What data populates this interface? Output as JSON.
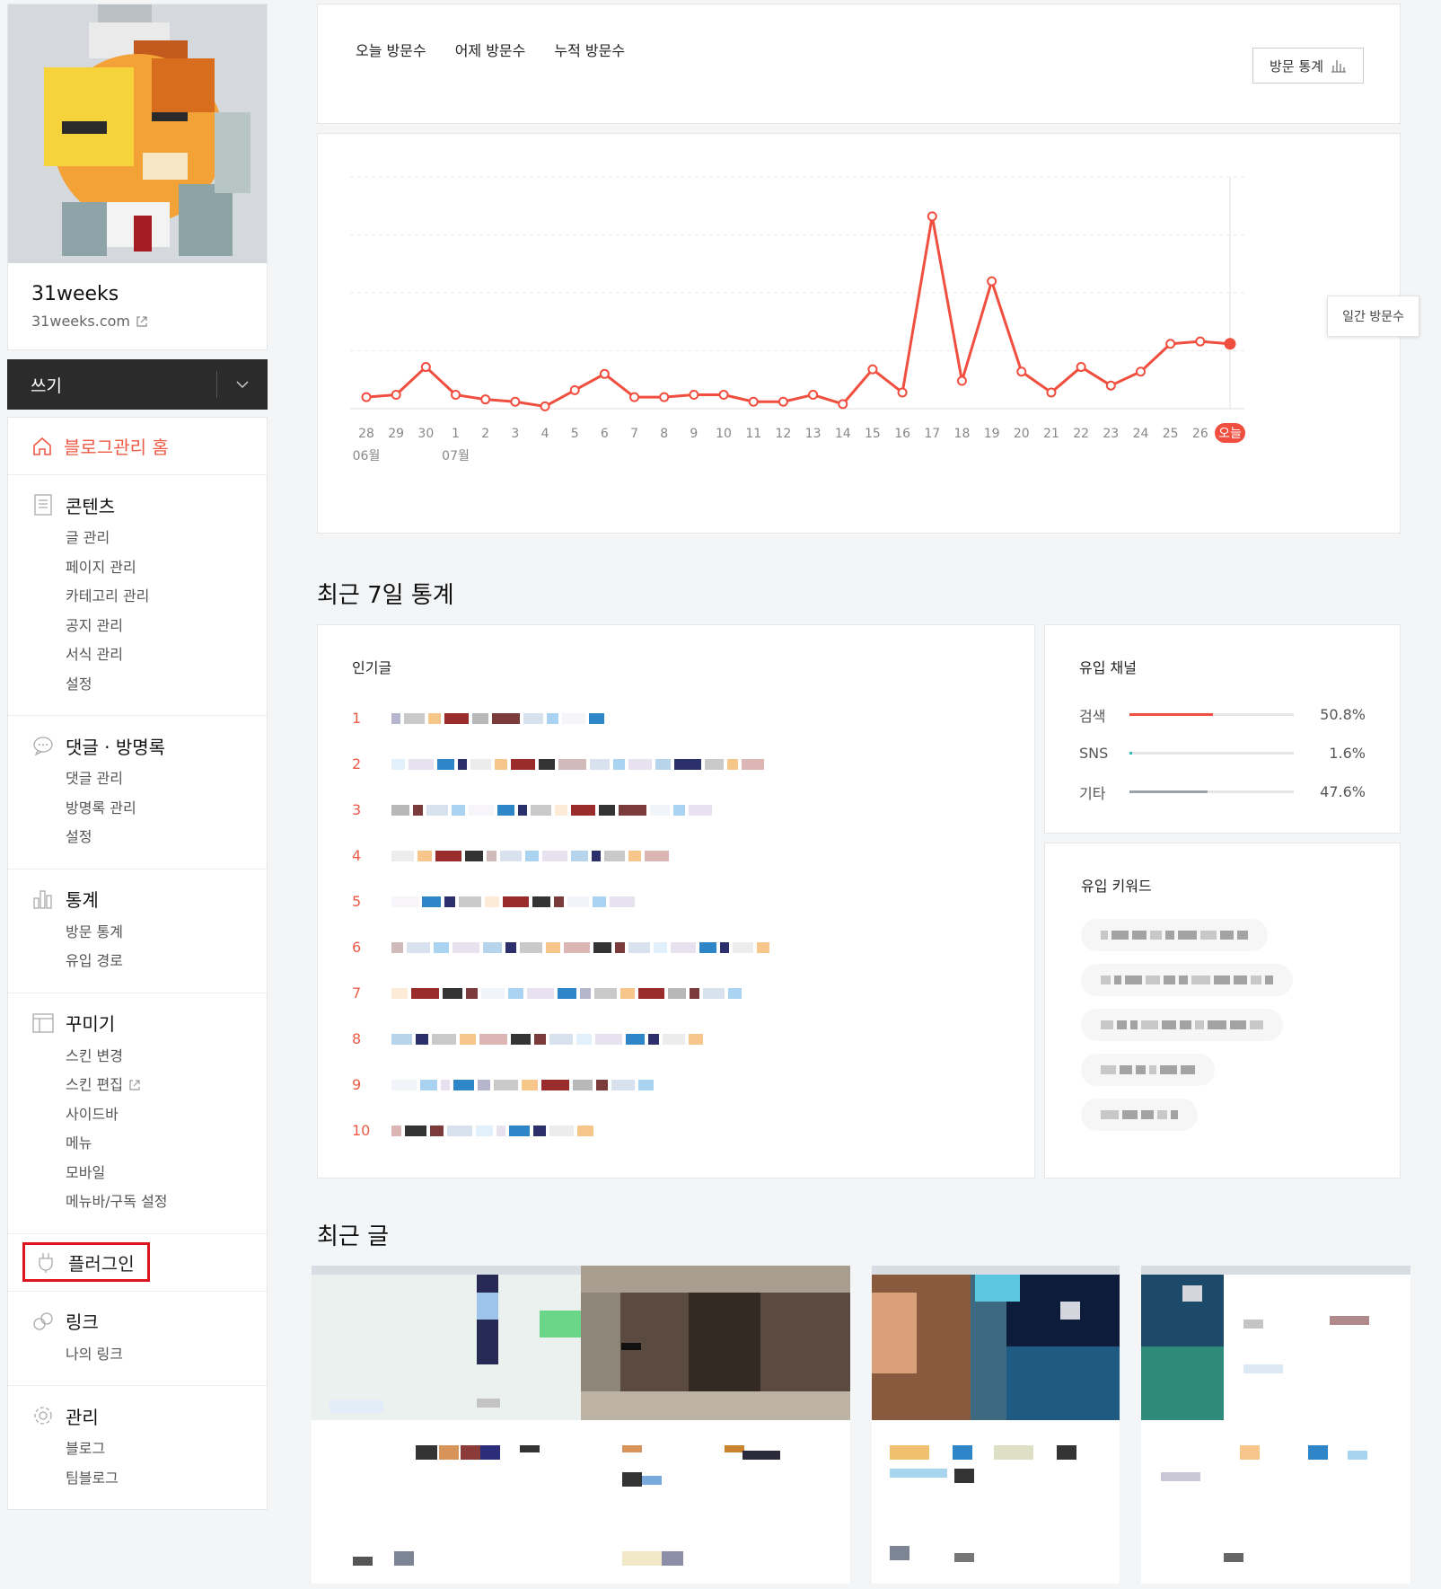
{
  "sidebar": {
    "blog_name": "31weeks",
    "blog_url": "31weeks.com",
    "write_label": "쓰기",
    "home_label": "블로그관리 홈",
    "groups": [
      {
        "title": "콘텐츠",
        "items": [
          "글 관리",
          "페이지 관리",
          "카테고리 관리",
          "공지 관리",
          "서식 관리",
          "설정"
        ]
      },
      {
        "title": "댓글 · 방명록",
        "items": [
          "댓글 관리",
          "방명록 관리",
          "설정"
        ]
      },
      {
        "title": "통계",
        "items": [
          "방문 통계",
          "유입 경로"
        ]
      },
      {
        "title": "꾸미기",
        "items": [
          "스킨 변경",
          "스킨 편집",
          "사이드바",
          "메뉴",
          "모바일",
          "메뉴바/구독 설정"
        ]
      },
      {
        "title": "플러그인",
        "items": []
      },
      {
        "title": "링크",
        "items": [
          "나의 링크"
        ]
      },
      {
        "title": "관리",
        "items": [
          "블로그",
          "팀블로그"
        ]
      }
    ]
  },
  "visits": {
    "tab_today": "오늘 방문수",
    "tab_yesterday": "어제 방문수",
    "tab_total": "누적 방문수",
    "stats_button": "방문 통계",
    "tooltip": "일간 방문수",
    "today_label": "오늘"
  },
  "chart_data": {
    "type": "line",
    "title": "",
    "series": [
      {
        "values": [
          5,
          6,
          18,
          6,
          4,
          3,
          1,
          8,
          15,
          5,
          5,
          6,
          6,
          3,
          3,
          6,
          2,
          17,
          7,
          83,
          12,
          55,
          16,
          7,
          18,
          10,
          16,
          28,
          29,
          28
        ]
      }
    ],
    "x": [
      "28",
      "29",
      "30",
      "1",
      "2",
      "3",
      "4",
      "5",
      "6",
      "7",
      "8",
      "9",
      "10",
      "11",
      "12",
      "13",
      "14",
      "15",
      "16",
      "17",
      "18",
      "19",
      "20",
      "21",
      "22",
      "23",
      "24",
      "25",
      "26",
      "오늘"
    ],
    "month_labels": [
      {
        "index": 0,
        "label": "06월"
      },
      {
        "index": 3,
        "label": "07월"
      }
    ],
    "ylim": [
      0,
      100
    ],
    "grid": true,
    "color": "#f04e3e"
  },
  "recent_stats": {
    "title": "최근 7일 통계",
    "popular_title": "인기글",
    "ranks": [
      "1",
      "2",
      "3",
      "4",
      "5",
      "6",
      "7",
      "8",
      "9",
      "10"
    ],
    "channels_title": "유입 채널",
    "channels": [
      {
        "name": "검색",
        "value": "50.8%",
        "fraction": 0.508,
        "color": "#f04e3e"
      },
      {
        "name": "SNS",
        "value": "1.6%",
        "fraction": 0.016,
        "color": "#2bb8b4"
      },
      {
        "name": "기타",
        "value": "47.6%",
        "fraction": 0.476,
        "color": "#9da3ad"
      }
    ],
    "keywords_title": "유입 키워드"
  },
  "recent_posts": {
    "title": "최근 글"
  }
}
